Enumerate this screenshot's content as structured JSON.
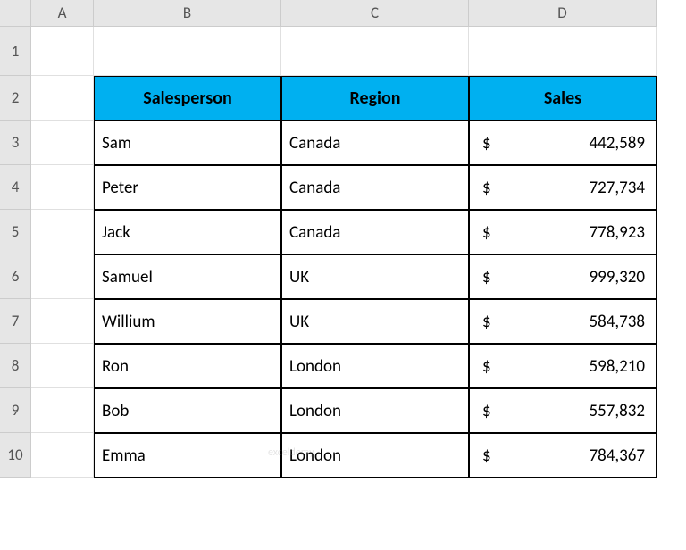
{
  "columns": {
    "corner": "",
    "A": "A",
    "B": "B",
    "C": "C",
    "D": "D"
  },
  "rows": {
    "1": "1",
    "2": "2",
    "3": "3",
    "4": "4",
    "5": "5",
    "6": "6",
    "7": "7",
    "8": "8",
    "9": "9",
    "10": "10"
  },
  "headers": {
    "salesperson": "Salesperson",
    "region": "Region",
    "sales": "Sales"
  },
  "currency_symbol": "$",
  "data": [
    {
      "sp": "Sam",
      "region": "Canada",
      "sales": "442,589"
    },
    {
      "sp": "Peter",
      "region": "Canada",
      "sales": "727,734"
    },
    {
      "sp": "Jack",
      "region": "Canada",
      "sales": "778,923"
    },
    {
      "sp": "Samuel",
      "region": "UK",
      "sales": "999,320"
    },
    {
      "sp": "Willium",
      "region": "UK",
      "sales": "584,738"
    },
    {
      "sp": "Ron",
      "region": "London",
      "sales": "598,210"
    },
    {
      "sp": "Bob",
      "region": "London",
      "sales": "557,832"
    },
    {
      "sp": "Emma",
      "region": "London",
      "sales": "784,367"
    }
  ],
  "watermark": "exceldemy"
}
